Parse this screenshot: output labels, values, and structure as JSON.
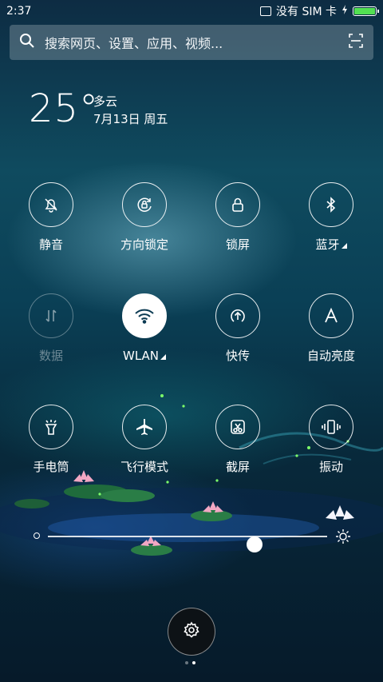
{
  "status_bar": {
    "time": "2:37",
    "sim_text": "没有 SIM 卡",
    "battery_level": 1.0,
    "battery_color": "#52e052"
  },
  "search": {
    "placeholder": "搜索网页、设置、应用、视频...",
    "icon": "search-icon",
    "scan_icon": "scan-icon"
  },
  "weather": {
    "temperature": "25°",
    "condition": "多云",
    "date": "7月13日 周五"
  },
  "toggles": [
    {
      "label": "静音",
      "icon": "silent-bell-icon",
      "state": "off"
    },
    {
      "label": "方向锁定",
      "icon": "rotation-lock-icon",
      "state": "off"
    },
    {
      "label": "锁屏",
      "icon": "lock-icon",
      "state": "off"
    },
    {
      "label": "蓝牙",
      "icon": "bluetooth-icon",
      "state": "off",
      "has_more": true
    },
    {
      "label": "数据",
      "icon": "data-arrows-icon",
      "state": "disabled"
    },
    {
      "label": "WLAN",
      "icon": "wifi-icon",
      "state": "on",
      "has_more": true
    },
    {
      "label": "快传",
      "icon": "quick-transfer-icon",
      "state": "off"
    },
    {
      "label": "自动亮度",
      "icon": "auto-brightness-icon",
      "state": "off"
    },
    {
      "label": "手电筒",
      "icon": "flashlight-icon",
      "state": "off"
    },
    {
      "label": "飞行模式",
      "icon": "airplane-icon",
      "state": "off"
    },
    {
      "label": "截屏",
      "icon": "screenshot-icon",
      "state": "off"
    },
    {
      "label": "振动",
      "icon": "vibrate-icon",
      "state": "off"
    }
  ],
  "brightness": {
    "level": 0.74,
    "min_icon": "brightness-low-icon",
    "max_icon": "brightness-high-icon"
  },
  "settings_button": {
    "icon": "gear-icon"
  },
  "page_indicator": {
    "count": 2,
    "current": 2
  }
}
